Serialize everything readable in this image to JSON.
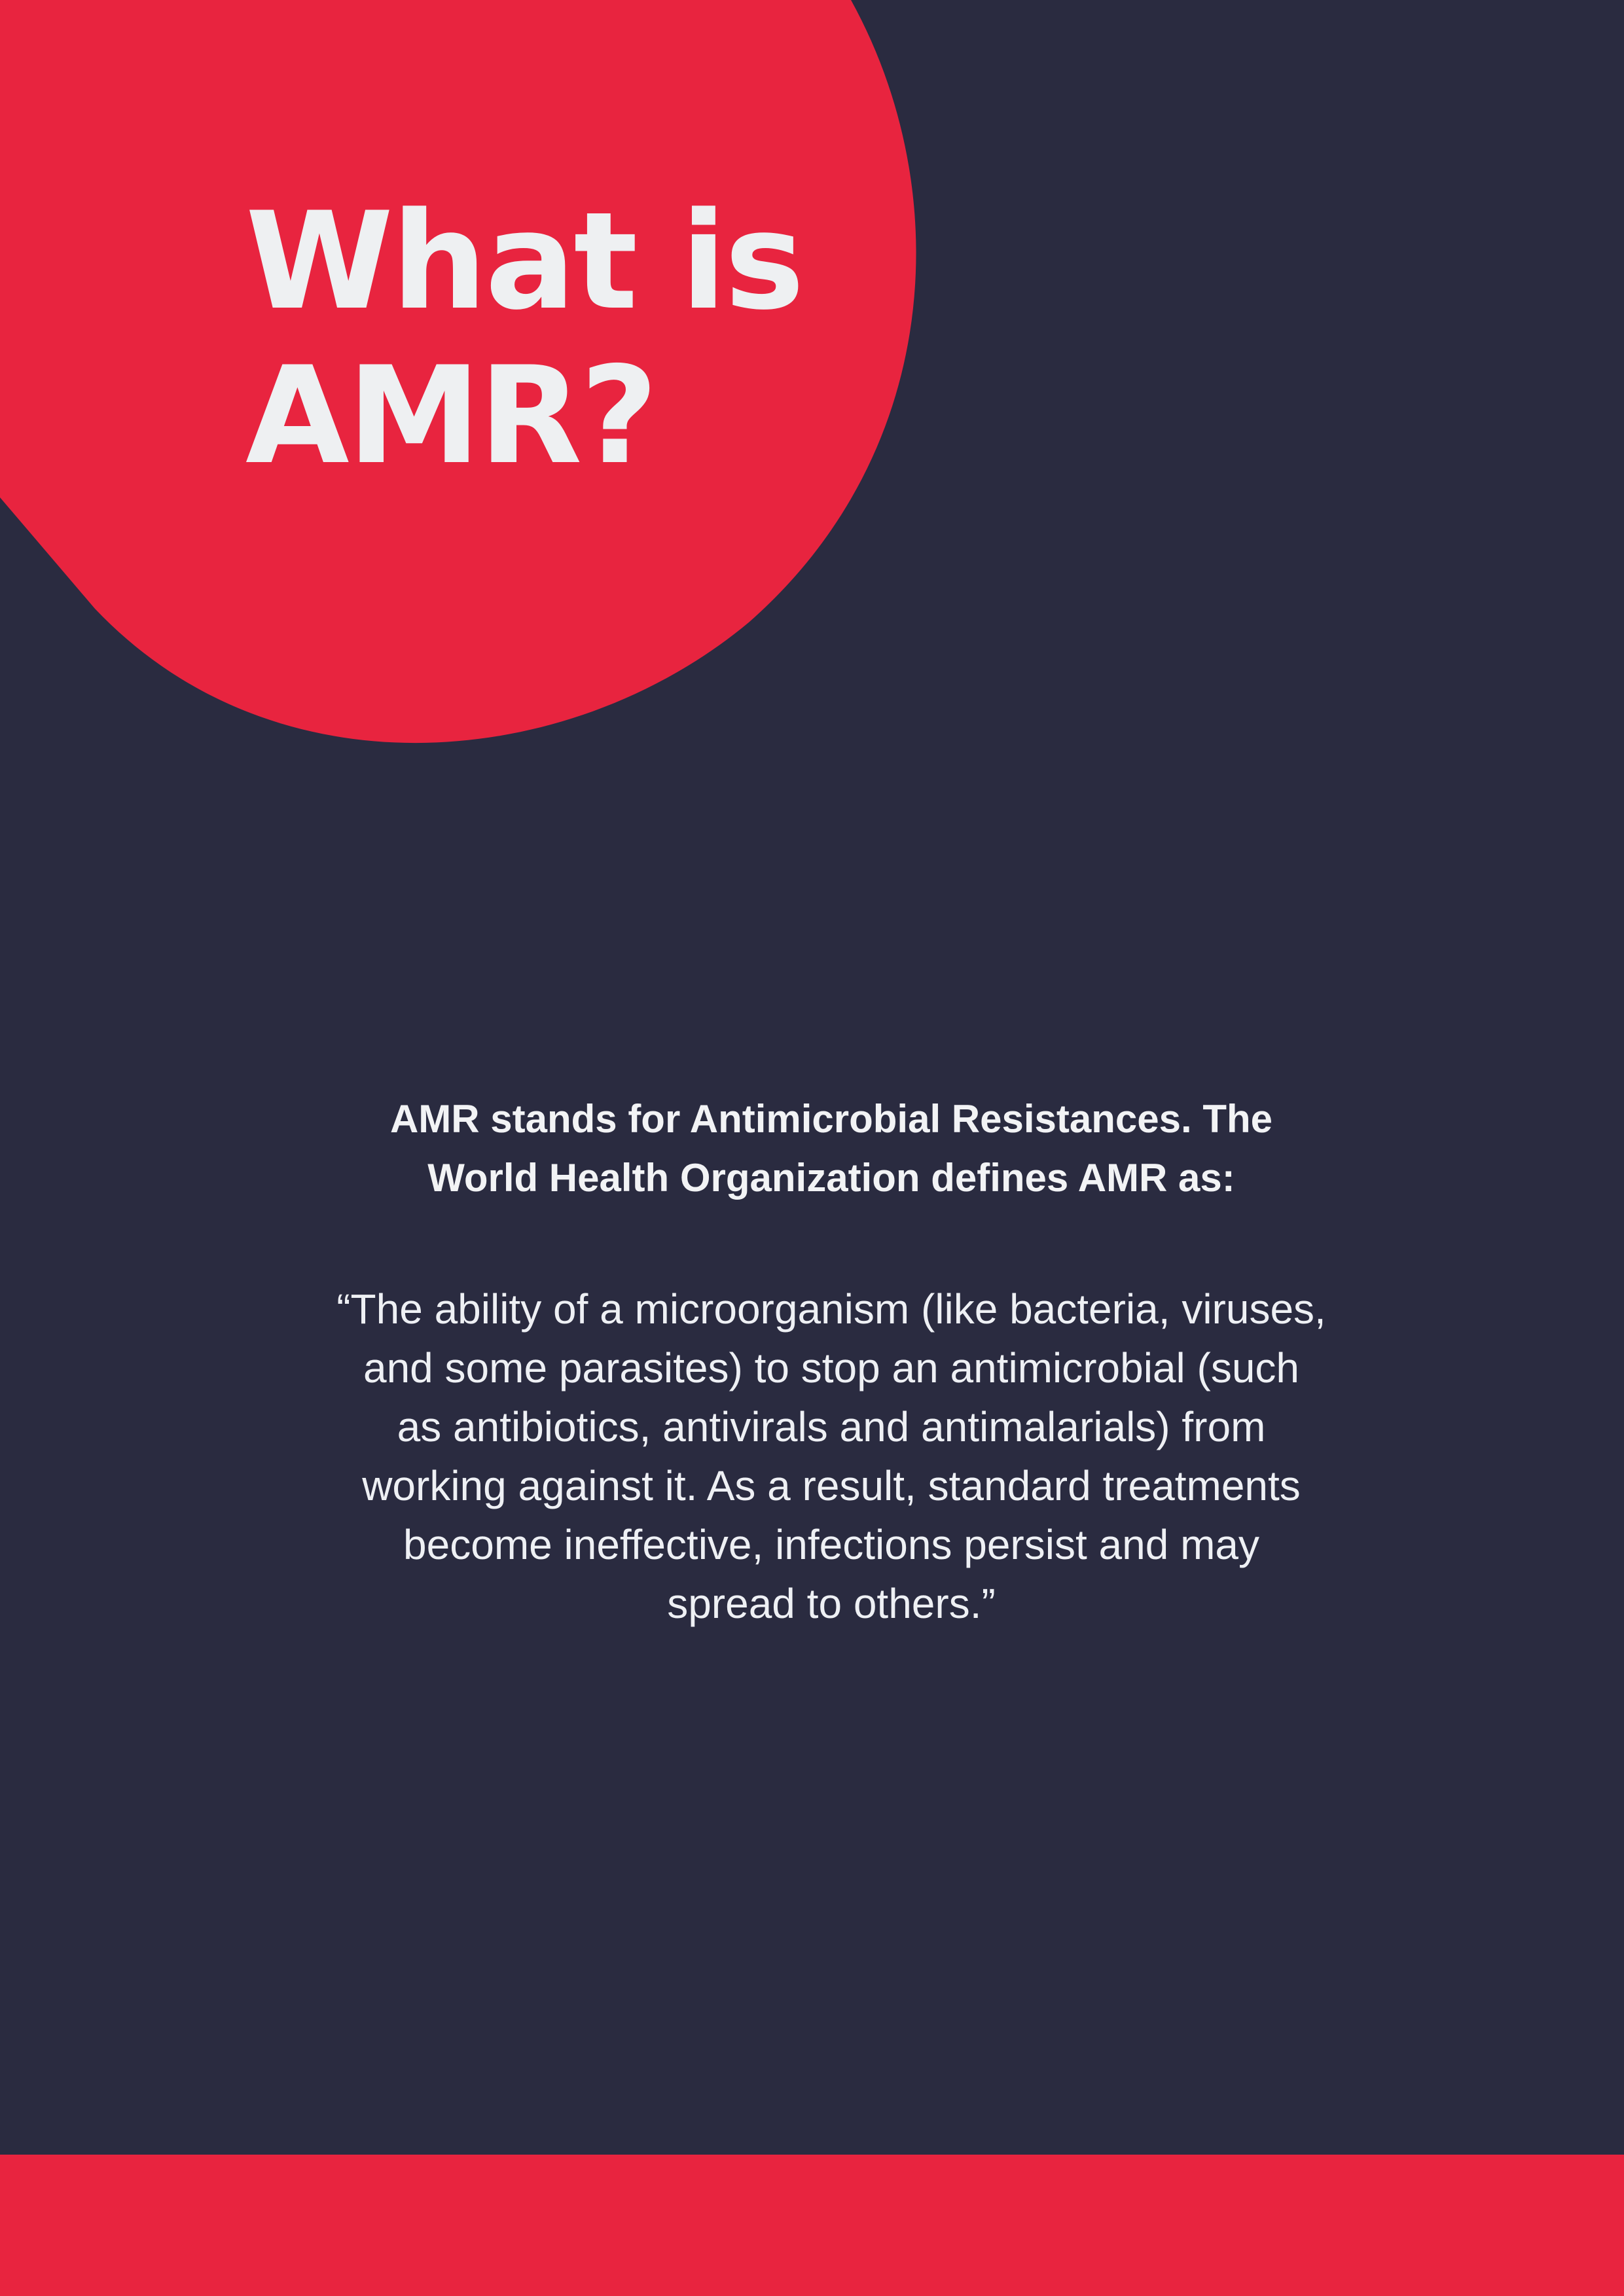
{
  "colors": {
    "background": "#2a2b40",
    "accent": "#e8243f",
    "text": "#eef0f2"
  },
  "title": {
    "line1": "What is",
    "line2": "AMR?"
  },
  "intro": {
    "line1": "AMR stands for Antimicrobial Resistances. The",
    "line2": "World Health Organization defines AMR as:"
  },
  "quote": {
    "line1": "“The ability of a microorganism (like bacteria, viruses,",
    "line2": "and some parasites) to stop an antimicrobial (such",
    "line3": "as antibiotics, antivirals and antimalarials) from",
    "line4": "working against it. As a result, standard treatments",
    "line5": "become ineffective, infections persist and may",
    "line6": "spread to others.”"
  }
}
